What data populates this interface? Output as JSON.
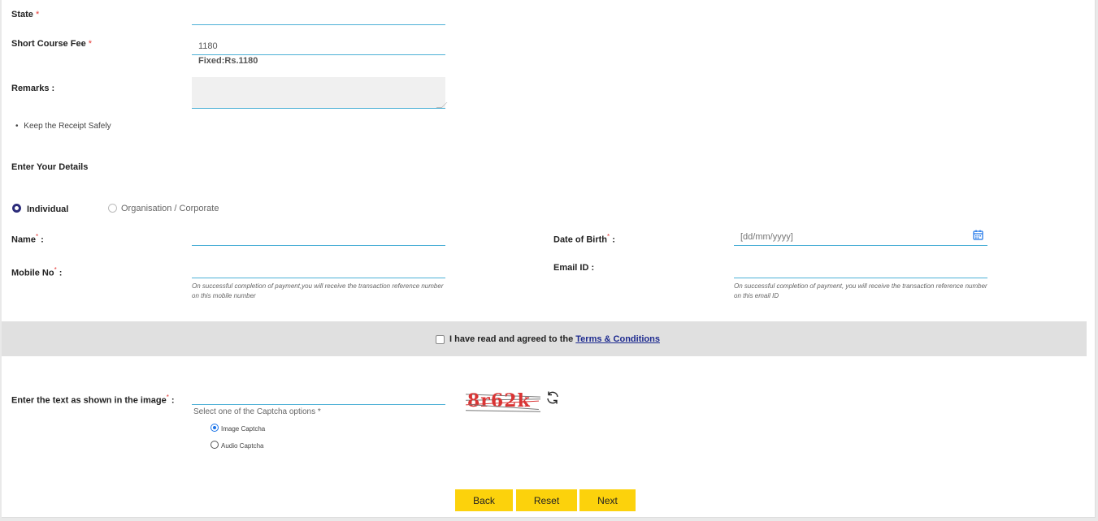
{
  "form": {
    "state_label": "State",
    "state_req": "*",
    "state_value": "",
    "fee_label": "Short Course Fee",
    "fee_req": "*",
    "fee_value": "1180",
    "fee_fixed": "Fixed:Rs.1180",
    "remarks_label": "Remarks :",
    "remarks_value": "",
    "receipt_note": "Keep the Receipt Safely",
    "details_heading": "Enter Your Details",
    "type_individual": "Individual",
    "type_org": "Organisation / Corporate",
    "name_label": "Name",
    "name_suffix": ":",
    "name_value": "",
    "dob_label": "Date of Birth",
    "dob_suffix": ":",
    "dob_placeholder": "[dd/mm/yyyy]",
    "mobile_label": "Mobile No",
    "mobile_suffix": ":",
    "mobile_value": "",
    "mobile_hint": "On successful completion of payment,you will receive the transaction reference number on this mobile number",
    "email_label": "Email ID :",
    "email_value": "",
    "email_hint": "On successful completion of payment, you will receive the transaction reference number on this email ID",
    "required_mark": "*"
  },
  "terms": {
    "text": "I have read and agreed to the",
    "link": "Terms & Conditions",
    "checked": false
  },
  "captcha": {
    "label": "Enter the text as shown in the image",
    "suffix": ":",
    "value": "",
    "options_label": "Select one of the Captcha options *",
    "option_image": "Image Captcha",
    "option_audio": "Audio Captcha",
    "selected": "Image Captcha",
    "image_text": "8r62k",
    "refresh_icon": "refresh-icon"
  },
  "buttons": {
    "back": "Back",
    "reset": "Reset",
    "next": "Next"
  },
  "colors": {
    "accent_underline": "#4cb0d6",
    "button_yellow": "#fcd20c",
    "radio_selected": "#2c2c7a",
    "required_red": "#e53935",
    "link_blue": "#1d2a8f"
  },
  "icons": {
    "calendar": "calendar-icon",
    "bullet": "bullet-icon"
  }
}
